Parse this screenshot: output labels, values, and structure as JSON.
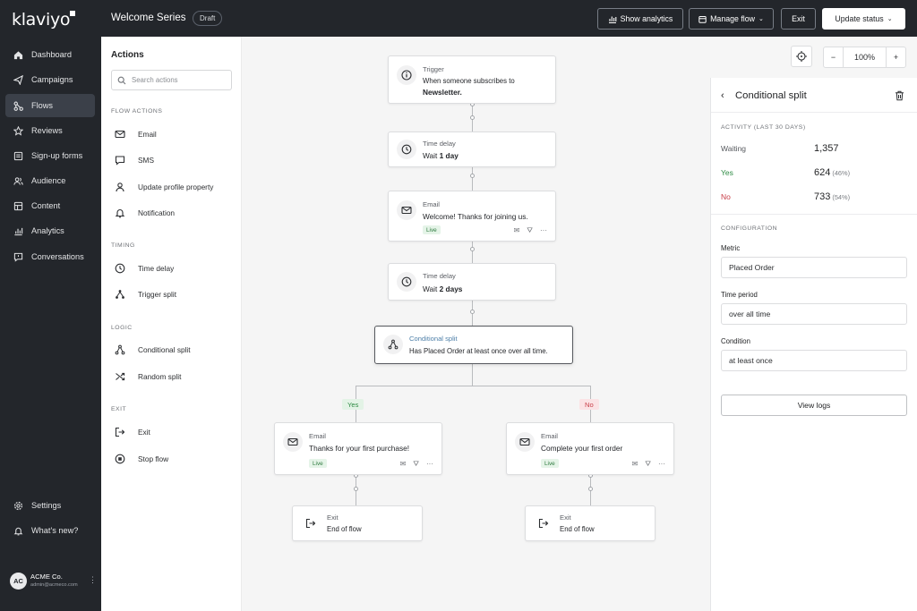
{
  "app": {
    "logo": "klaviyo"
  },
  "sidebar": {
    "items": [
      {
        "label": "Dashboard",
        "icon": "home-icon"
      },
      {
        "label": "Campaigns",
        "icon": "send-icon"
      },
      {
        "label": "Flows",
        "icon": "flows-icon",
        "active": true
      },
      {
        "label": "Reviews",
        "icon": "star-icon"
      },
      {
        "label": "Sign-up forms",
        "icon": "form-icon"
      },
      {
        "label": "Audience",
        "icon": "people-icon"
      },
      {
        "label": "Content",
        "icon": "content-icon"
      },
      {
        "label": "Analytics",
        "icon": "chart-icon"
      },
      {
        "label": "Conversations",
        "icon": "chat-icon"
      }
    ],
    "bottom": [
      {
        "label": "Settings",
        "icon": "gear-icon"
      },
      {
        "label": "What's new?",
        "icon": "bell-icon"
      }
    ],
    "user": {
      "initials": "AC",
      "name": "ACME Co.",
      "email": "admin@acmeco.com"
    }
  },
  "topbar": {
    "title": "Welcome Series",
    "badge": "Draft",
    "show_analytics": "Show analytics",
    "manage_flow": "Manage flow",
    "exit": "Exit",
    "update_status": "Update status"
  },
  "actions": {
    "title": "Actions",
    "search_placeholder": "Search actions",
    "sections": [
      {
        "title": "FLOW ACTIONS",
        "items": [
          "Email",
          "SMS",
          "Update profile property",
          "Notification"
        ]
      },
      {
        "title": "TIMING",
        "items": [
          "Time delay",
          "Trigger split"
        ]
      },
      {
        "title": "LOGIC",
        "items": [
          "Conditional split",
          "Random split"
        ]
      },
      {
        "title": "EXIT",
        "items": [
          "Exit",
          "Stop flow"
        ]
      }
    ]
  },
  "canvas": {
    "zoom": "100%",
    "trigger": {
      "title": "Trigger",
      "line1": "When someone subscribes to",
      "line2": "Newsletter."
    },
    "delay1": {
      "title": "Time delay",
      "prefix": "Wait ",
      "value": "1 day"
    },
    "email1": {
      "title": "Email",
      "subject": "Welcome! Thanks for joining us.",
      "status": "Live"
    },
    "delay2": {
      "title": "Time delay",
      "prefix": "Wait ",
      "value": "2 days"
    },
    "split": {
      "title": "Conditional split",
      "desc": "Has Placed Order at least once over all time."
    },
    "yes_label": "Yes",
    "no_label": "No",
    "email_yes": {
      "title": "Email",
      "subject": "Thanks for your first purchase!",
      "status": "Live"
    },
    "email_no": {
      "title": "Email",
      "subject": "Complete your first order",
      "status": "Live"
    },
    "exit_yes": {
      "title": "Exit",
      "desc": "End of flow"
    },
    "exit_no": {
      "title": "Exit",
      "desc": "End of flow"
    }
  },
  "panel": {
    "title": "Conditional split",
    "activity_title": "ACTIVITY (LAST 30 DAYS)",
    "waiting": {
      "label": "Waiting",
      "value": "1,357"
    },
    "yes": {
      "label": "Yes",
      "value": "624",
      "pct": "(46%)"
    },
    "no": {
      "label": "No",
      "value": "733",
      "pct": "(54%)"
    },
    "config_title": "CONFIGURATION",
    "metric_label": "Metric",
    "metric_value": "Placed Order",
    "period_label": "Time period",
    "period_value": "over all time",
    "condition_label": "Condition",
    "condition_value": "at least once",
    "view_logs": "View logs"
  },
  "colors": {
    "sidebar_bg": "#23262b",
    "yes_green": "#2e8b44",
    "no_red": "#c8404a",
    "split_title": "#4d7fa8"
  }
}
